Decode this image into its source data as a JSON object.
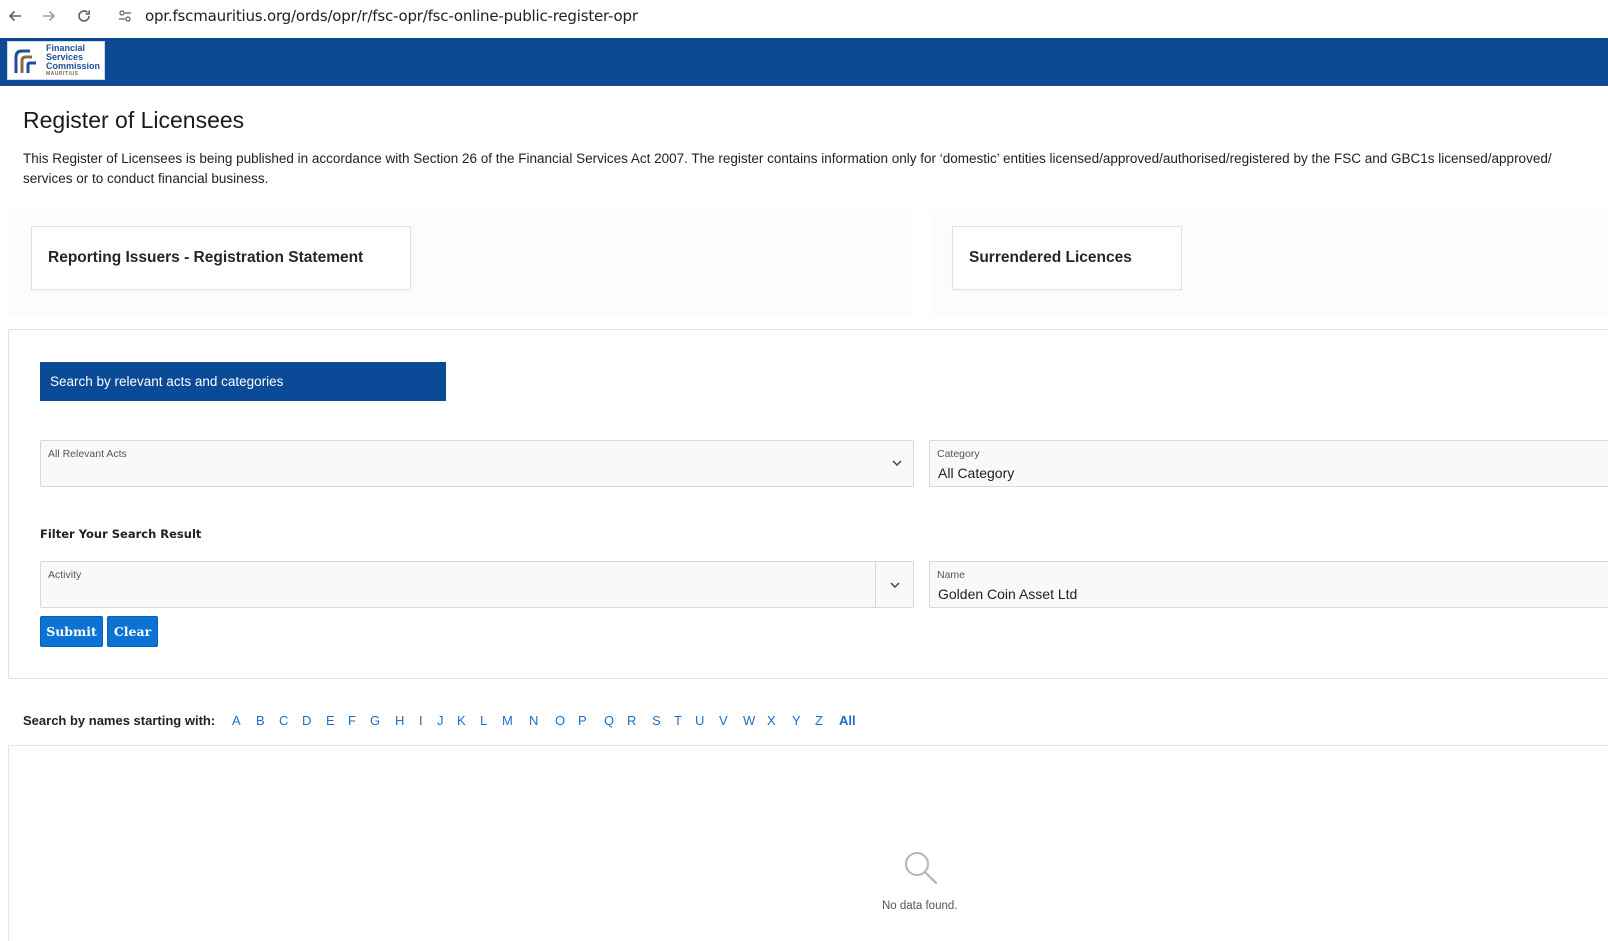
{
  "browser": {
    "url": "opr.fscmauritius.org/ords/opr/r/fsc-opr/fsc-online-public-register-opr"
  },
  "header": {
    "logo_lines": [
      "Financial",
      "Services",
      "Commission",
      "MAURITIUS"
    ],
    "brand_color": "#0d4a94"
  },
  "page": {
    "title": "Register of Licensees",
    "intro_line1": "This Register of Licensees is being published in accordance with Section 26 of the Financial Services Act 2007. The register contains information only for ‘domestic’ entities licensed/approved/authorised/registered by the FSC and GBC1s licensed/approved/",
    "intro_line2": "services or to conduct financial business."
  },
  "cards": {
    "reporting": "Reporting Issuers - Registration Statement",
    "surrendered": "Surrendered Licences"
  },
  "search": {
    "banner": "Search by relevant acts and categories",
    "acts_label": "All Relevant Acts",
    "acts_value": "",
    "category_label": "Category",
    "category_value": "All Category",
    "filter_heading": "Filter Your Search Result",
    "activity_label": "Activity",
    "activity_value": "",
    "name_label": "Name",
    "name_value": "Golden Coin Asset Ltd",
    "submit_label": "Submit",
    "clear_label": "Clear",
    "button_color": "#0c72d4"
  },
  "alphabet": {
    "label": "Search by names starting with:",
    "letters": [
      "A",
      "B",
      "C",
      "D",
      "E",
      "F",
      "G",
      "H",
      "I",
      "J",
      "K",
      "L",
      "M",
      "N",
      "O",
      "P",
      "Q",
      "R",
      "S",
      "T",
      "U",
      "V",
      "W",
      "X",
      "Y",
      "Z"
    ],
    "all_label": "All",
    "link_color": "#1e6fc5"
  },
  "results": {
    "empty_text": "No data found.",
    "empty_icon": "search-icon"
  }
}
